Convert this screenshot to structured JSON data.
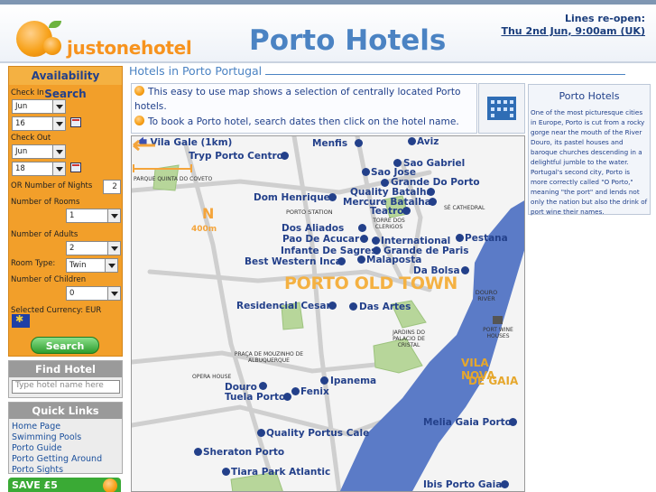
{
  "header": {
    "logo_text": "justonehotel",
    "site_title": "Porto Hotels",
    "notice_line1": "Lines re-open:",
    "notice_line2": "Thu 2nd Jun, 9:00am (UK)"
  },
  "sidebar": {
    "availability": {
      "title": "Availability Search",
      "check_in_label": "Check In",
      "check_in_month": "Jun",
      "check_in_day": "16",
      "check_out_label": "Check Out",
      "check_out_month": "Jun",
      "check_out_day": "18",
      "nights_label": "OR Number of Nights",
      "nights_value": "2",
      "rooms_label": "Number of Rooms",
      "rooms_value": "1",
      "adults_label": "Number of Adults",
      "adults_value": "2",
      "room_type_label": "Room Type:",
      "room_type_value": "Twin",
      "children_label": "Number of Children",
      "children_value": "0",
      "currency_label": "Selected Currency: EUR",
      "search_button": "Search"
    },
    "find_hotel": {
      "title": "Find Hotel",
      "placeholder": "Type hotel name here"
    },
    "quick_links": {
      "title": "Quick Links",
      "items": [
        "Home Page",
        "Swimming Pools",
        "Porto Guide",
        "Porto Getting Around",
        "Porto Sights"
      ]
    },
    "promo": "SAVE £5"
  },
  "main": {
    "heading": "Hotels in Porto Portugal",
    "intro_line1": "This easy to use map shows a selection of centrally located Porto hotels.",
    "intro_line2": "To book a Porto hotel, search dates then click on the hotel name.",
    "info_title": "Porto Hotels",
    "info_text": "One of the most picturesque cities in Europe, Porto is cut from a rocky gorge near the mouth of the River Douro, its pastel houses and baroque churches descending in a delightful jumble to the water. Portugal's second city, Porto is more correctly called \"O Porto,\" meaning \"the port\" and lends not only the nation but also the drink of port wine their names."
  },
  "map": {
    "back_link": "Vila Gale (1km)",
    "hotels": {
      "menfis": "Menfis",
      "aviz": "Aviz",
      "tryp": "Tryp Porto Centro",
      "sao_gabriel": "Sao Gabriel",
      "sao_jose": "Sao Jose",
      "grande_do_porto": "Grande Do Porto",
      "quality_batalha": "Quality Batalha",
      "dom_henrique": "Dom Henrique",
      "mercure_batalha": "Mercure Batalha",
      "teatro": "Teatro",
      "dos_aliados": "Dos Aliados",
      "pao_de_acucar": "Pao De Acucar",
      "international": "International",
      "pestana": "Pestana",
      "infante_de_sagres": "Infante De Sagres",
      "grande_de_paris": "Grande de Paris",
      "best_western_inca": "Best Western Inca",
      "malaposta": "Malaposta",
      "da_bolsa": "Da Bolsa",
      "residencial_cesar": "Residencial Cesar",
      "das_artes": "Das Artes",
      "ipanema": "Ipanema",
      "douro": "Douro",
      "fenix": "Fenix",
      "tuela_porto": "Tuela Porto",
      "melia_gaia_porto": "Melia Gaia Porto",
      "quality_portus_cale": "Quality Portus Cale",
      "sheraton_porto": "Sheraton Porto",
      "tiara_park_atlantic": "Tiara Park Atlantic",
      "ibis_porto_gaia": "Ibis Porto Gaia"
    },
    "places": {
      "parque_quinta": "PARQUE QUINTA DO COVETO",
      "porto_station": "PORTO STATION",
      "torre_dos_clerigos": "TORRE DOS CLERIGOS",
      "se_cathedral": "SÉ CATHEDRAL",
      "douro_river": "DOURO RIVER",
      "port_wine_houses": "PORT WINE HOUSES",
      "jardins": "JARDINS DO PALACIO DE CRISTAL",
      "praca": "PRAÇA DE MOUZINHO DE ALBUQUERQUE",
      "opera_house": "OPERA HOUSE"
    },
    "old_town": "PORTO OLD TOWN",
    "vila_nova_line1": "VILA NOVA",
    "vila_nova_line2": "DE GAIA",
    "compass_letter": "N",
    "scale": "400m"
  }
}
